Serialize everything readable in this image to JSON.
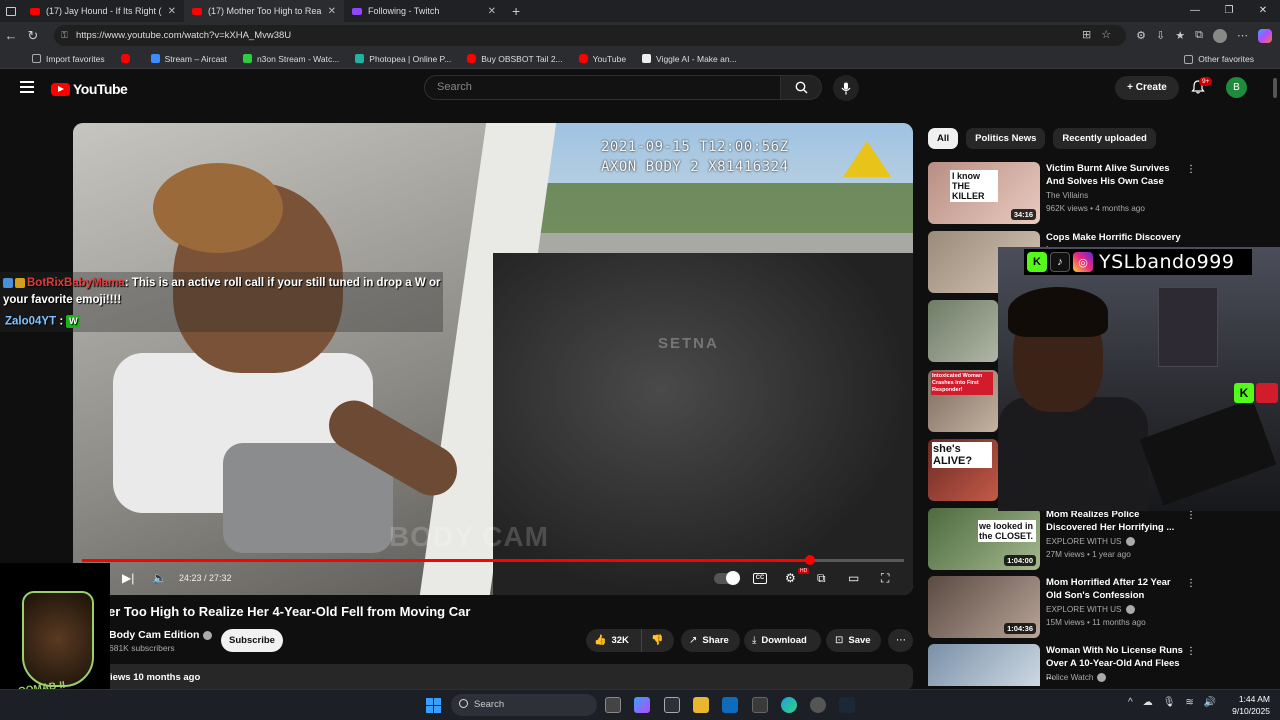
{
  "browser": {
    "tabs": [
      {
        "title": "(17) Jay Hound - If Its Right (Offic",
        "active": false,
        "icon": "youtube"
      },
      {
        "title": "(17) Mother Too High to Realize H",
        "active": true,
        "icon": "youtube"
      },
      {
        "title": "Following - Twitch",
        "active": false,
        "icon": "twitch"
      }
    ],
    "url": "https://www.youtube.com/watch?v=kXHA_Mvw38U",
    "bookmarks": [
      "Import favorites",
      "Stream – Aircast",
      "n3on Stream - Watc...",
      "Photopea | Online P...",
      "Buy OBSBOT Tail 2...",
      "YouTube",
      "Viggle AI - Make an..."
    ],
    "other_favorites": "Other favorites"
  },
  "youtube": {
    "logo_text": "YouTube",
    "search_placeholder": "Search",
    "create_label": "Create",
    "notif_count": "9+",
    "avatar_letter": "B"
  },
  "video": {
    "timestamp_line1": "2021-09-15 T12:00:56Z",
    "timestamp_line2": "AXON BODY 2 X81416324",
    "watermark": "BODY CAM",
    "door_text": "SETNA",
    "time_display": "24:23 / 27:32",
    "progress_fraction": 0.886,
    "title": "er Too High to Realize Her 4-Year-Old Fell from Moving Car",
    "channel": "Body Cam Edition",
    "subscribers": "681K subscribers",
    "subscribe_label": "Subscribe",
    "likes": "32K",
    "share_label": "Share",
    "download_label": "Download",
    "save_label": "Save",
    "views_line": "iews  10 months ago"
  },
  "chips": [
    "All",
    "Politics News",
    "Recently uploaded"
  ],
  "recommendations": [
    {
      "title": "Victim Burnt Alive Survives And Solves His Own Case",
      "channel": "The Villains",
      "views": "962K views • 4 months ago",
      "duration": "34:16",
      "thumb_color": "#c9a59a"
    },
    {
      "title": "Cops Make Horrific Discovery in",
      "channel": "",
      "views": "",
      "duration": "",
      "thumb_color": "#8a7d70"
    },
    {
      "title": "",
      "channel": "",
      "views": "",
      "duration": "",
      "thumb_color": "#6f7c66"
    },
    {
      "title": "",
      "channel": "",
      "views": "",
      "duration": "",
      "thumb_color": "#7b6a5e"
    },
    {
      "title": "",
      "channel": "",
      "views": "",
      "duration": "",
      "thumb_color": "#9b4a3c"
    },
    {
      "title": "Mom Realizes Police Discovered Her Horrifying ...",
      "channel": "EXPLORE WITH US",
      "views": "27M views • 1 year ago",
      "duration": "1:04:00",
      "thumb_color": "#5e7d4e"
    },
    {
      "title": "Mom Horrified After 12 Year Old Son's Confession",
      "channel": "EXPLORE WITH US",
      "views": "15M views • 11 months ago",
      "duration": "1:04:36",
      "thumb_color": "#6a5a52"
    },
    {
      "title": "Woman With No License Runs Over A 10-Year-Old And Flees ...",
      "channel": "Police Watch",
      "views": "",
      "duration": "",
      "thumb_color": "#8a9fb5"
    }
  ],
  "thumb_text": {
    "rec1": "I know THE KILLER",
    "rec4": "Intoxicated Woman Crashes into First Responder!",
    "rec5": "she's ALIVE?",
    "rec6": "we looked in the CLOSET."
  },
  "overlay": {
    "chat_user1": "BotRixBabyMama",
    "chat_msg1": ": This is an active roll call if your still tuned in drop a W or your favorite emoji!!!!",
    "chat_user2": "Zalo04YT",
    "chat_sep2": " : ",
    "chat_emote": "W",
    "streamer_name": "YSLbando999",
    "logo_text": "OOMAB-II"
  },
  "taskbar": {
    "search_label": "Search",
    "time": "1:44 AM",
    "date": "9/10/2025"
  }
}
